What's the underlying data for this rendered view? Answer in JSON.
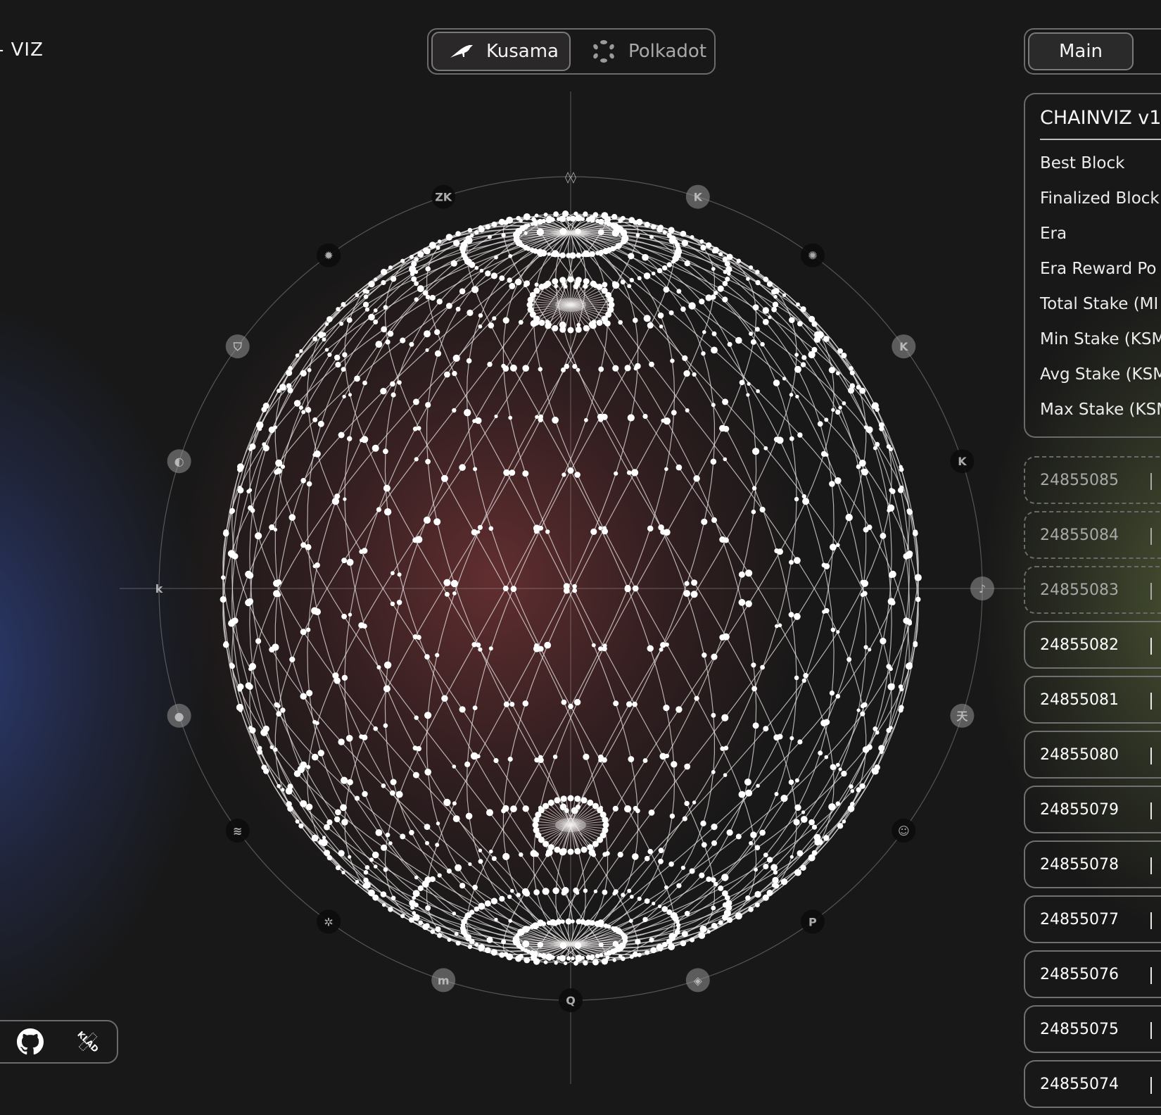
{
  "app": {
    "logo_text": "- VIZ"
  },
  "network_switch": {
    "options": [
      {
        "label": "Kusama",
        "icon": "kusama-bird-icon",
        "active": true
      },
      {
        "label": "Polkadot",
        "icon": "polkadot-icon",
        "active": false
      }
    ]
  },
  "view_tabs": {
    "active_label": "Main"
  },
  "info_panel": {
    "title": "CHAINVIZ v1.",
    "rows": [
      {
        "label": "Best Block"
      },
      {
        "label": "Finalized Block"
      },
      {
        "label": "Era"
      },
      {
        "label": "Era Reward Po"
      },
      {
        "label": "Total Stake (MI"
      },
      {
        "label": "Min Stake (KSM"
      },
      {
        "label": "Avg Stake (KSM"
      },
      {
        "label": "Max Stake (KSM"
      }
    ]
  },
  "blocks": [
    {
      "number": "24855085",
      "status": "pending"
    },
    {
      "number": "24855084",
      "status": "pending"
    },
    {
      "number": "24855083",
      "status": "pending"
    },
    {
      "number": "24855082",
      "status": "finalized"
    },
    {
      "number": "24855081",
      "status": "finalized"
    },
    {
      "number": "24855080",
      "status": "finalized"
    },
    {
      "number": "24855079",
      "status": "finalized"
    },
    {
      "number": "24855078",
      "status": "finalized"
    },
    {
      "number": "24855077",
      "status": "finalized"
    },
    {
      "number": "24855076",
      "status": "finalized"
    },
    {
      "number": "24855075",
      "status": "finalized"
    },
    {
      "number": "24855074",
      "status": "finalized"
    }
  ],
  "parachains": [
    {
      "name": "parachain-top",
      "glyph": "◊◊",
      "style": "plain"
    },
    {
      "name": "parachain-k-1",
      "glyph": "K",
      "style": "light"
    },
    {
      "name": "parachain-bifrost",
      "glyph": "✺",
      "style": "dark"
    },
    {
      "name": "parachain-k-2",
      "glyph": "K",
      "style": "light"
    },
    {
      "name": "parachain-k-3",
      "glyph": "K",
      "style": "dark"
    },
    {
      "name": "parachain-music",
      "glyph": "♪",
      "style": "light"
    },
    {
      "name": "parachain-tian",
      "glyph": "天",
      "style": "light"
    },
    {
      "name": "parachain-robot",
      "glyph": "☺",
      "style": "dark"
    },
    {
      "name": "parachain-p",
      "glyph": "P",
      "style": "dark"
    },
    {
      "name": "parachain-leaf",
      "glyph": "◈",
      "style": "light"
    },
    {
      "name": "parachain-q",
      "glyph": "Q",
      "style": "dark"
    },
    {
      "name": "parachain-m",
      "glyph": "m",
      "style": "light"
    },
    {
      "name": "parachain-crab",
      "glyph": "✲",
      "style": "dark"
    },
    {
      "name": "parachain-stripes",
      "glyph": "≋",
      "style": "dark"
    },
    {
      "name": "parachain-sphere",
      "glyph": "●",
      "style": "light"
    },
    {
      "name": "parachain-k-outline",
      "glyph": "k",
      "style": "plain"
    },
    {
      "name": "parachain-duck",
      "glyph": "◐",
      "style": "light"
    },
    {
      "name": "parachain-shield",
      "glyph": "⛉",
      "style": "light"
    },
    {
      "name": "parachain-sun",
      "glyph": "✹",
      "style": "dark"
    },
    {
      "name": "parachain-zk",
      "glyph": "ZK",
      "style": "dark"
    }
  ],
  "footer": {
    "links": [
      {
        "icon": "github-icon",
        "label": "GitHub"
      },
      {
        "icon": "kilt-icon",
        "label": "KLAD"
      }
    ]
  }
}
